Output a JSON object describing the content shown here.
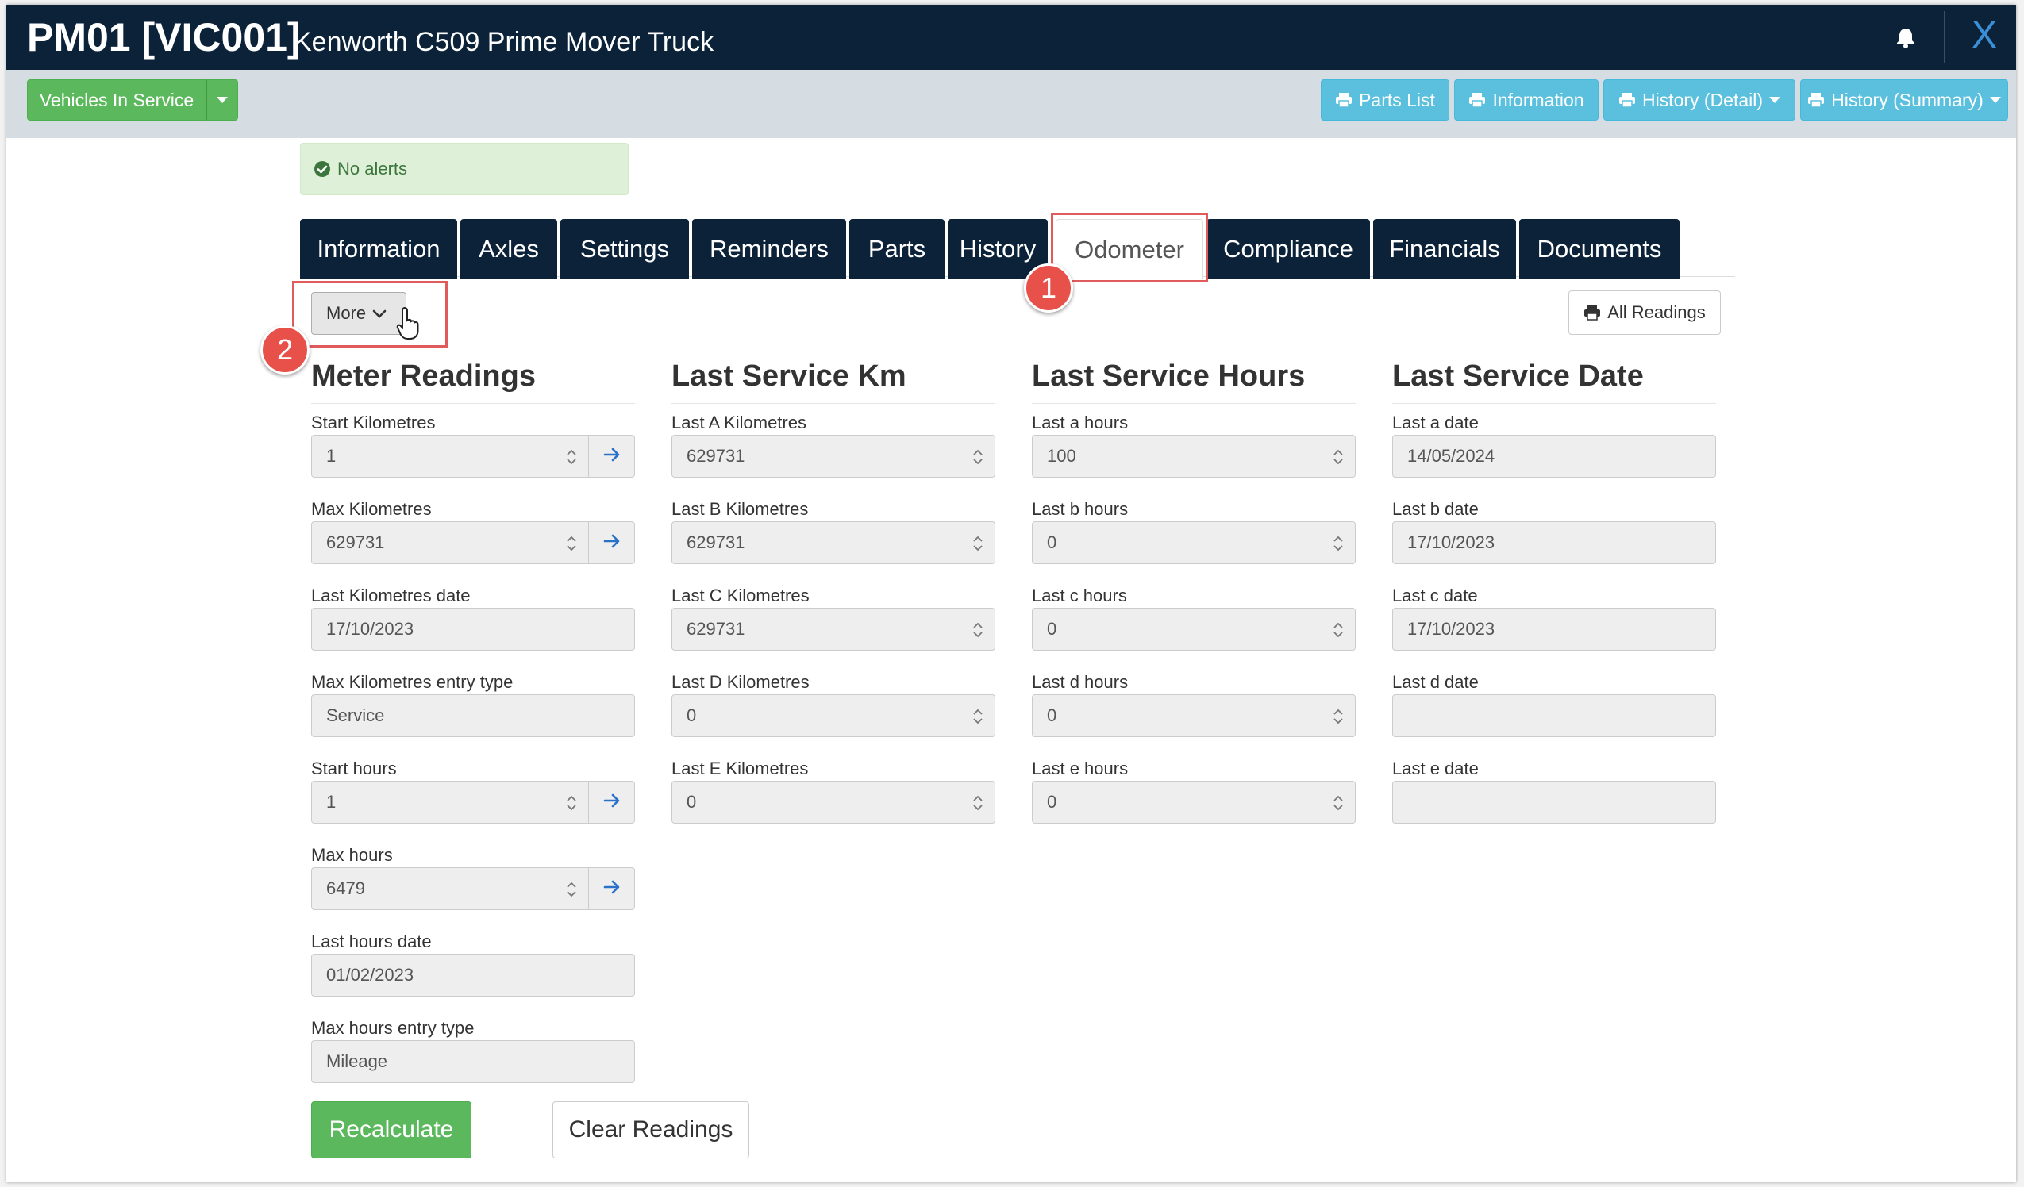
{
  "header": {
    "code": "PM01 [VIC001]",
    "name": "Kenworth C509 Prime Mover Truck",
    "close_label": "X"
  },
  "toolbar": {
    "status_label": "Vehicles In Service",
    "buttons": {
      "parts_list": "Parts List",
      "information": "Information",
      "history_detail": "History (Detail)",
      "history_summary": "History (Summary)"
    }
  },
  "alert": {
    "text": "No alerts"
  },
  "tabs": [
    "Information",
    "Axles",
    "Settings",
    "Reminders",
    "Parts",
    "History",
    "Odometer",
    "Compliance",
    "Financials",
    "Documents"
  ],
  "active_tab": "Odometer",
  "annotations": {
    "marker1": "1",
    "marker2": "2"
  },
  "more_label": "More",
  "all_readings_label": "All Readings",
  "meter_readings": {
    "title": "Meter Readings",
    "fields": [
      {
        "label": "Start Kilometres",
        "value": "1"
      },
      {
        "label": "Max Kilometres",
        "value": "629731"
      },
      {
        "label": "Last Kilometres date",
        "value": "17/10/2023"
      },
      {
        "label": "Max Kilometres entry type",
        "value": "Service"
      },
      {
        "label": "Start hours",
        "value": "1"
      },
      {
        "label": "Max hours",
        "value": "6479"
      },
      {
        "label": "Last hours date",
        "value": "01/02/2023"
      },
      {
        "label": "Max hours entry type",
        "value": "Mileage"
      }
    ]
  },
  "last_service_km": {
    "title": "Last Service Km",
    "fields": [
      {
        "label": "Last A Kilometres",
        "value": "629731"
      },
      {
        "label": "Last B Kilometres",
        "value": "629731"
      },
      {
        "label": "Last C Kilometres",
        "value": "629731"
      },
      {
        "label": "Last D Kilometres",
        "value": "0"
      },
      {
        "label": "Last E Kilometres",
        "value": "0"
      }
    ]
  },
  "last_service_hours": {
    "title": "Last Service Hours",
    "fields": [
      {
        "label": "Last a hours",
        "value": "100"
      },
      {
        "label": "Last b hours",
        "value": "0"
      },
      {
        "label": "Last c hours",
        "value": "0"
      },
      {
        "label": "Last d hours",
        "value": "0"
      },
      {
        "label": "Last e hours",
        "value": "0"
      }
    ]
  },
  "last_service_date": {
    "title": "Last Service Date",
    "fields": [
      {
        "label": "Last a date",
        "value": "14/05/2024"
      },
      {
        "label": "Last b date",
        "value": "17/10/2023"
      },
      {
        "label": "Last c date",
        "value": "17/10/2023"
      },
      {
        "label": "Last d date",
        "value": ""
      },
      {
        "label": "Last e date",
        "value": ""
      }
    ]
  },
  "actions": {
    "recalculate": "Recalculate",
    "clear": "Clear Readings"
  },
  "colors": {
    "navy": "#0b2239",
    "green": "#5cb85c",
    "info": "#5bc0de",
    "annotation_red": "#e8504a"
  }
}
